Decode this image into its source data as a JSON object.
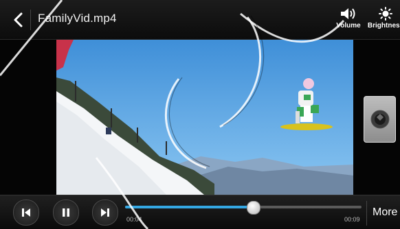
{
  "header": {
    "title": "FamilyVid.mp4",
    "volume_label": "Volume",
    "brightness_label": "Brightness"
  },
  "player": {
    "current_time": "00:04",
    "total_time": "00:09",
    "progress": 0.54,
    "more_label": "More"
  },
  "colors": {
    "accent": "#34a7e3"
  }
}
